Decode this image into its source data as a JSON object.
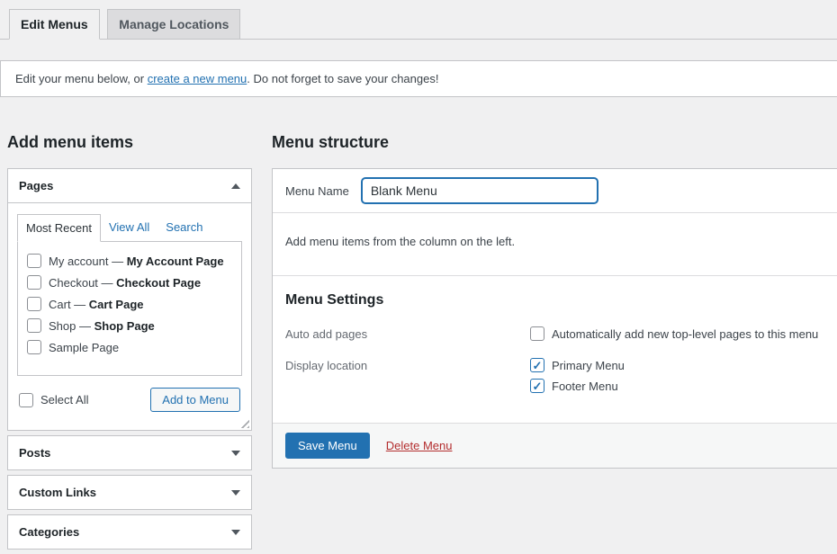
{
  "tabs": {
    "edit_menus": "Edit Menus",
    "manage_locations": "Manage Locations"
  },
  "notice": {
    "text_before": "Edit your menu below, or ",
    "link": "create a new menu",
    "text_after": ". Do not forget to save your changes!"
  },
  "left_column": {
    "title": "Add menu items",
    "pages_panel": {
      "title": "Pages",
      "tabs": {
        "most_recent": "Most Recent",
        "view_all": "View All",
        "search": "Search"
      },
      "items": [
        {
          "text": "My account — ",
          "bold": "My Account Page",
          "checked": false
        },
        {
          "text": "Checkout — ",
          "bold": "Checkout Page",
          "checked": false
        },
        {
          "text": "Cart — ",
          "bold": "Cart Page",
          "checked": false
        },
        {
          "text": "Shop — ",
          "bold": "Shop Page",
          "checked": false
        },
        {
          "text": "Sample Page",
          "bold": "",
          "checked": false
        }
      ],
      "select_all_label": "Select All",
      "select_all_checked": false,
      "add_to_menu_button": "Add to Menu"
    },
    "collapsed_panels": [
      {
        "title": "Posts"
      },
      {
        "title": "Custom Links"
      },
      {
        "title": "Categories"
      }
    ]
  },
  "menu_structure": {
    "title": "Menu structure",
    "menu_name_label": "Menu Name",
    "menu_name_value": "Blank Menu",
    "hint": "Add menu items from the column on the left.",
    "settings": {
      "title": "Menu Settings",
      "auto_add_label": "Auto add pages",
      "auto_add_option": "Automatically add new top-level pages to this menu",
      "auto_add_checked": false,
      "display_location_label": "Display location",
      "locations": [
        {
          "label": "Primary Menu",
          "checked": true
        },
        {
          "label": "Footer Menu",
          "checked": true
        }
      ]
    },
    "save_button": "Save Menu",
    "delete_link": "Delete Menu"
  },
  "colors": {
    "accent": "#2271b1",
    "danger": "#b32d2e",
    "border": "#c3c4c7",
    "page_background": "#f0f0f1"
  }
}
